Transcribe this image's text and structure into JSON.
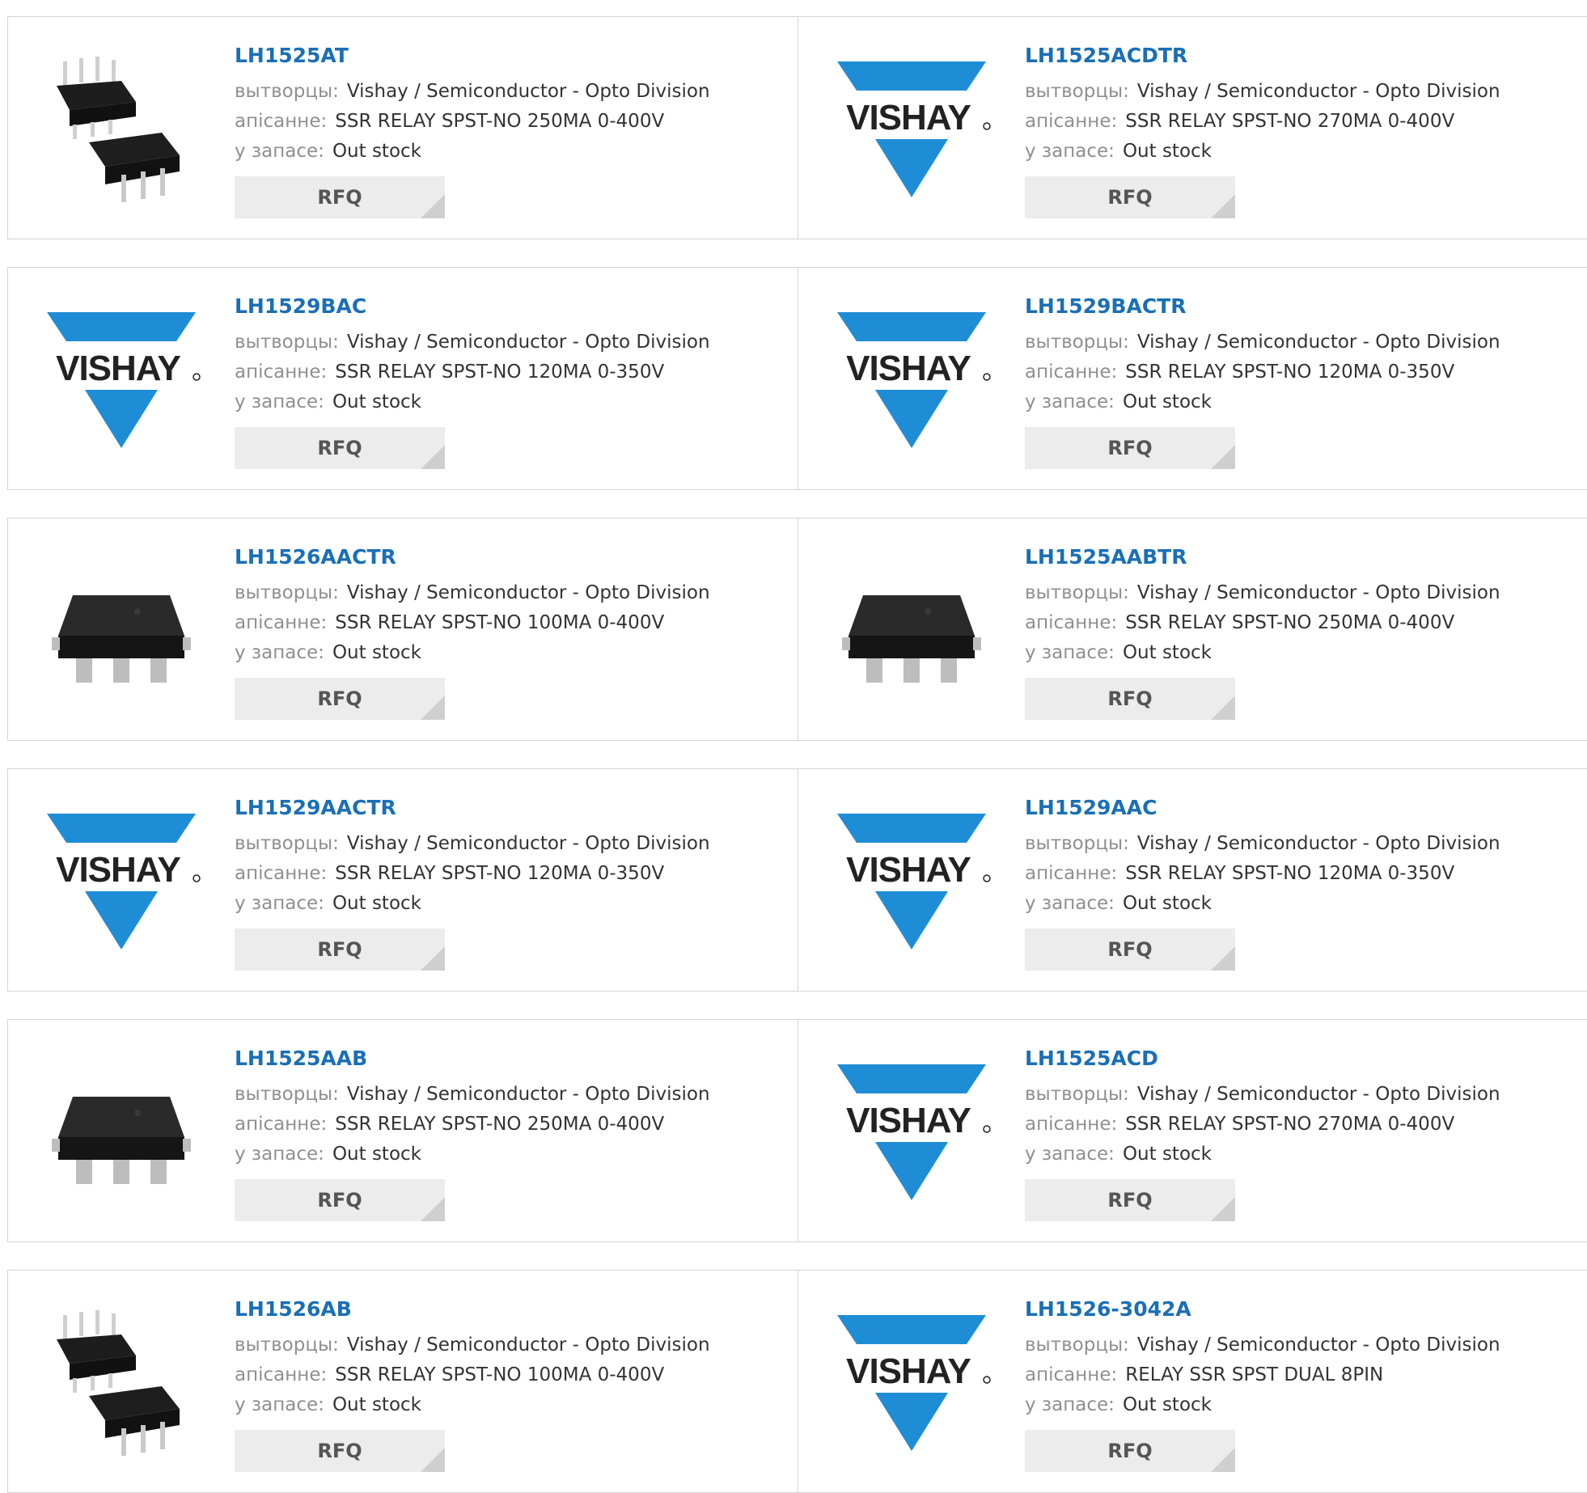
{
  "labels": {
    "maker": "вытворцы:",
    "desc": "апісанне:",
    "stock": "у запасе:",
    "rfq": "RFQ"
  },
  "colors": {
    "link": "#1a6fb6",
    "vishay_blue": "#1f8dd6",
    "label_gray": "#8f8f8f"
  },
  "products": [
    {
      "part": "LH1525AT",
      "maker": "Vishay / Semiconductor - Opto Division",
      "desc": "SSR RELAY SPST-NO 250MA 0-400V",
      "stock": "Out stock",
      "image": "dip-chip"
    },
    {
      "part": "LH1525ACDTR",
      "maker": "Vishay / Semiconductor - Opto Division",
      "desc": "SSR RELAY SPST-NO 270MA 0-400V",
      "stock": "Out stock",
      "image": "vishay-logo"
    },
    {
      "part": "LH1529BAC",
      "maker": "Vishay / Semiconductor - Opto Division",
      "desc": "SSR RELAY SPST-NO 120MA 0-350V",
      "stock": "Out stock",
      "image": "vishay-logo"
    },
    {
      "part": "LH1529BACTR",
      "maker": "Vishay / Semiconductor - Opto Division",
      "desc": "SSR RELAY SPST-NO 120MA 0-350V",
      "stock": "Out stock",
      "image": "vishay-logo"
    },
    {
      "part": "LH1526AACTR",
      "maker": "Vishay / Semiconductor - Opto Division",
      "desc": "SSR RELAY SPST-NO 100MA 0-400V",
      "stock": "Out stock",
      "image": "smd-chip"
    },
    {
      "part": "LH1525AABTR",
      "maker": "Vishay / Semiconductor - Opto Division",
      "desc": "SSR RELAY SPST-NO 250MA 0-400V",
      "stock": "Out stock",
      "image": "smd-chip"
    },
    {
      "part": "LH1529AACTR",
      "maker": "Vishay / Semiconductor - Opto Division",
      "desc": "SSR RELAY SPST-NO 120MA 0-350V",
      "stock": "Out stock",
      "image": "vishay-logo"
    },
    {
      "part": "LH1529AAC",
      "maker": "Vishay / Semiconductor - Opto Division",
      "desc": "SSR RELAY SPST-NO 120MA 0-350V",
      "stock": "Out stock",
      "image": "vishay-logo"
    },
    {
      "part": "LH1525AAB",
      "maker": "Vishay / Semiconductor - Opto Division",
      "desc": "SSR RELAY SPST-NO 250MA 0-400V",
      "stock": "Out stock",
      "image": "smd-chip"
    },
    {
      "part": "LH1525ACD",
      "maker": "Vishay / Semiconductor - Opto Division",
      "desc": "SSR RELAY SPST-NO 270MA 0-400V",
      "stock": "Out stock",
      "image": "vishay-logo"
    },
    {
      "part": "LH1526AB",
      "maker": "Vishay / Semiconductor - Opto Division",
      "desc": "SSR RELAY SPST-NO 100MA 0-400V",
      "stock": "Out stock",
      "image": "dip-chip"
    },
    {
      "part": "LH1526-3042A",
      "maker": "Vishay / Semiconductor - Opto Division",
      "desc": "RELAY SSR SPST DUAL 8PIN",
      "stock": "Out stock",
      "image": "vishay-logo"
    }
  ]
}
